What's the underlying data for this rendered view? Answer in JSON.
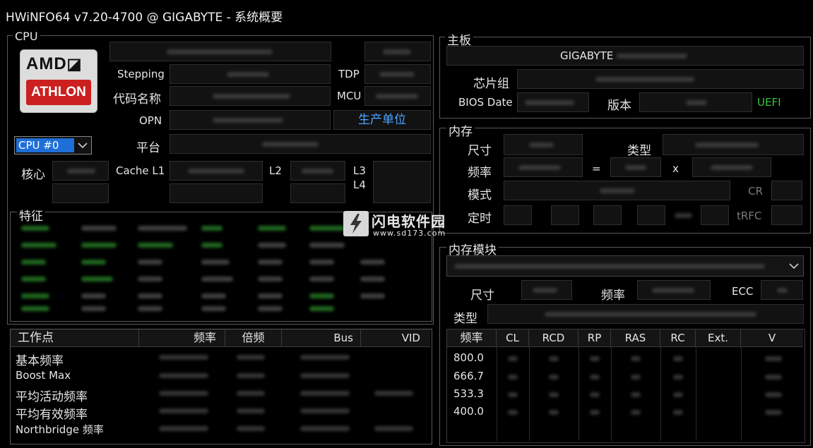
{
  "window": {
    "title": "HWiNFO64 v7.20-4700 @ GIGABYTE  - 系统概要"
  },
  "colors": {
    "background": "#000000",
    "green_text": "#39c339",
    "blue_text": "#4da6ff",
    "amd_red": "#cc1f1f"
  },
  "cpu": {
    "group_label": "CPU",
    "logo": {
      "brand": "AMD",
      "brand_mark": "◪",
      "line": "ATHLON"
    },
    "labels": {
      "stepping": "Stepping",
      "tdp": "TDP",
      "codename": "代码名称",
      "mcu": "MCU",
      "opn": "OPN",
      "production_unit": "生产单位",
      "platform": "平台",
      "cores": "核心",
      "cache_l1": "Cache L1",
      "l2": "L2",
      "l3": "L3",
      "l4": "L4"
    },
    "selector": {
      "value": "CPU #0",
      "arrow": "chevron-down-icon"
    },
    "features_label": "特征"
  },
  "operating_points": {
    "headers": [
      "工作点",
      "频率",
      "倍频",
      "Bus",
      "VID"
    ],
    "rows": [
      "基本频率",
      "Boost Max",
      "平均活动频率",
      "平均有效频率",
      "Northbridge 频率"
    ]
  },
  "motherboard": {
    "group_label": "主板",
    "name": "GIGABYTE",
    "labels": {
      "chipset": "芯片组",
      "bios_date": "BIOS Date",
      "version": "版本",
      "uefi": "UEFI"
    }
  },
  "memory": {
    "group_label": "内存",
    "labels": {
      "size": "尺寸",
      "type": "类型",
      "frequency": "频率",
      "equals": "=",
      "times": "x",
      "mode": "模式",
      "cr": "CR",
      "timing": "定时",
      "trfc": "tRFC"
    }
  },
  "memory_modules": {
    "group_label": "内存模块",
    "dropdown_arrow": "chevron-down-icon",
    "labels": {
      "size": "尺寸",
      "frequency": "频率",
      "ecc": "ECC",
      "type": "类型"
    },
    "table": {
      "headers": [
        "频率",
        "CL",
        "RCD",
        "RP",
        "RAS",
        "RC",
        "Ext.",
        "V"
      ],
      "frequencies": [
        "800.0",
        "666.7",
        "533.3",
        "400.0"
      ]
    }
  },
  "watermark": {
    "name": "闪电软件园",
    "url": "www.sd173.com"
  }
}
